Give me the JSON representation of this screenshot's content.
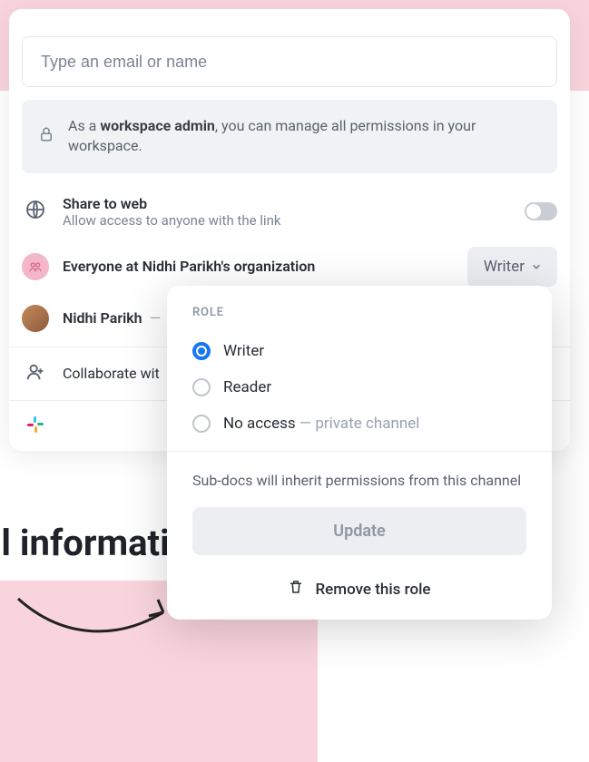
{
  "search": {
    "placeholder": "Type an email or name"
  },
  "admin_notice": {
    "prefix": "As a ",
    "bold": "workspace admin",
    "suffix": ", you can manage all permissions in your workspace."
  },
  "share_web": {
    "title": "Share to web",
    "subtitle": "Allow access to anyone with the link",
    "enabled": false
  },
  "org_row": {
    "label": "Everyone at Nidhi Parikh's organization",
    "role": "Writer"
  },
  "user_row": {
    "name": "Nidhi Parikh",
    "dash": "—"
  },
  "collaborate": {
    "label_truncated": "Collaborate wit"
  },
  "background": {
    "heading": "al information"
  },
  "popover": {
    "section_label": "ROLE",
    "options": [
      {
        "label": "Writer",
        "selected": true
      },
      {
        "label": "Reader",
        "selected": false
      },
      {
        "label": "No access",
        "suffix": " — private channel",
        "selected": false
      }
    ],
    "note": "Sub-docs will inherit permissions from this channel",
    "update_label": "Update",
    "remove_label": "Remove this role"
  },
  "colors": {
    "accent": "#1876f2",
    "pink": "#f9d4dd",
    "muted": "#8f97a3"
  }
}
